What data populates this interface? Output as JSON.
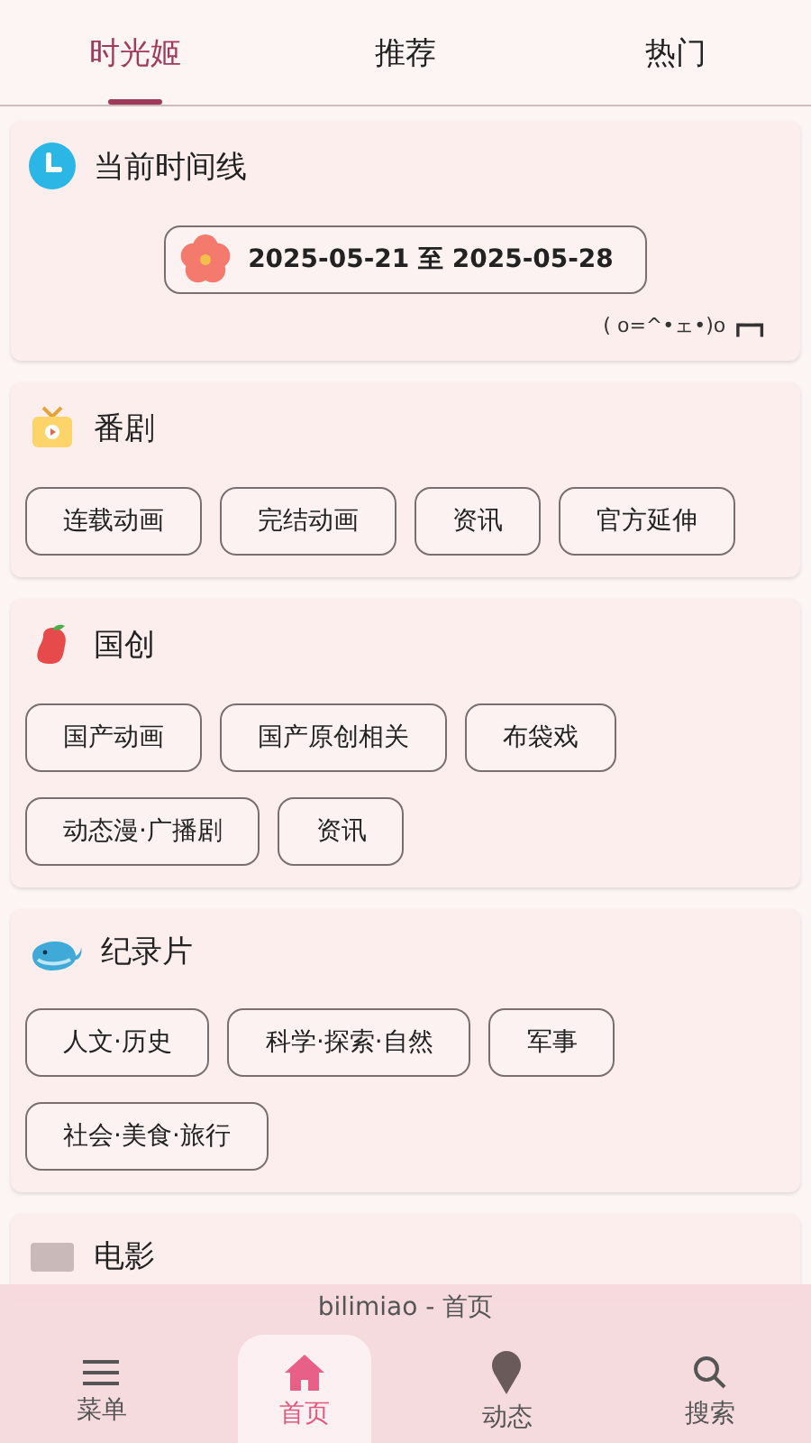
{
  "tabs": [
    {
      "label": "时光姬",
      "selected": true
    },
    {
      "label": "推荐",
      "selected": false
    },
    {
      "label": "热门",
      "selected": false
    }
  ],
  "sections": [
    {
      "kind": "timeline",
      "title": "当前时间线",
      "date_range": "2025-05-21 至 2025-05-28",
      "kaomoji": "( o=^•ェ•)o ┏━┓"
    },
    {
      "kind": "bangumi",
      "title": "番剧",
      "chips": [
        "连载动画",
        "完结动画",
        "资讯",
        "官方延伸"
      ]
    },
    {
      "kind": "guochuang",
      "title": "国创",
      "chips": [
        "国产动画",
        "国产原创相关",
        "布袋戏",
        "动态漫·广播剧",
        "资讯"
      ]
    },
    {
      "kind": "documentary",
      "title": "纪录片",
      "chips": [
        "人文·历史",
        "科学·探索·自然",
        "军事",
        "社会·美食·旅行"
      ]
    },
    {
      "kind": "movie",
      "title": "电影"
    }
  ],
  "bottom_bar": {
    "title": "bilimiao - 首页",
    "items": [
      {
        "kind": "menu",
        "label": "菜单",
        "selected": false
      },
      {
        "kind": "home",
        "label": "首页",
        "selected": true
      },
      {
        "kind": "feed",
        "label": "动态",
        "selected": false
      },
      {
        "kind": "search",
        "label": "搜索",
        "selected": false
      }
    ]
  }
}
